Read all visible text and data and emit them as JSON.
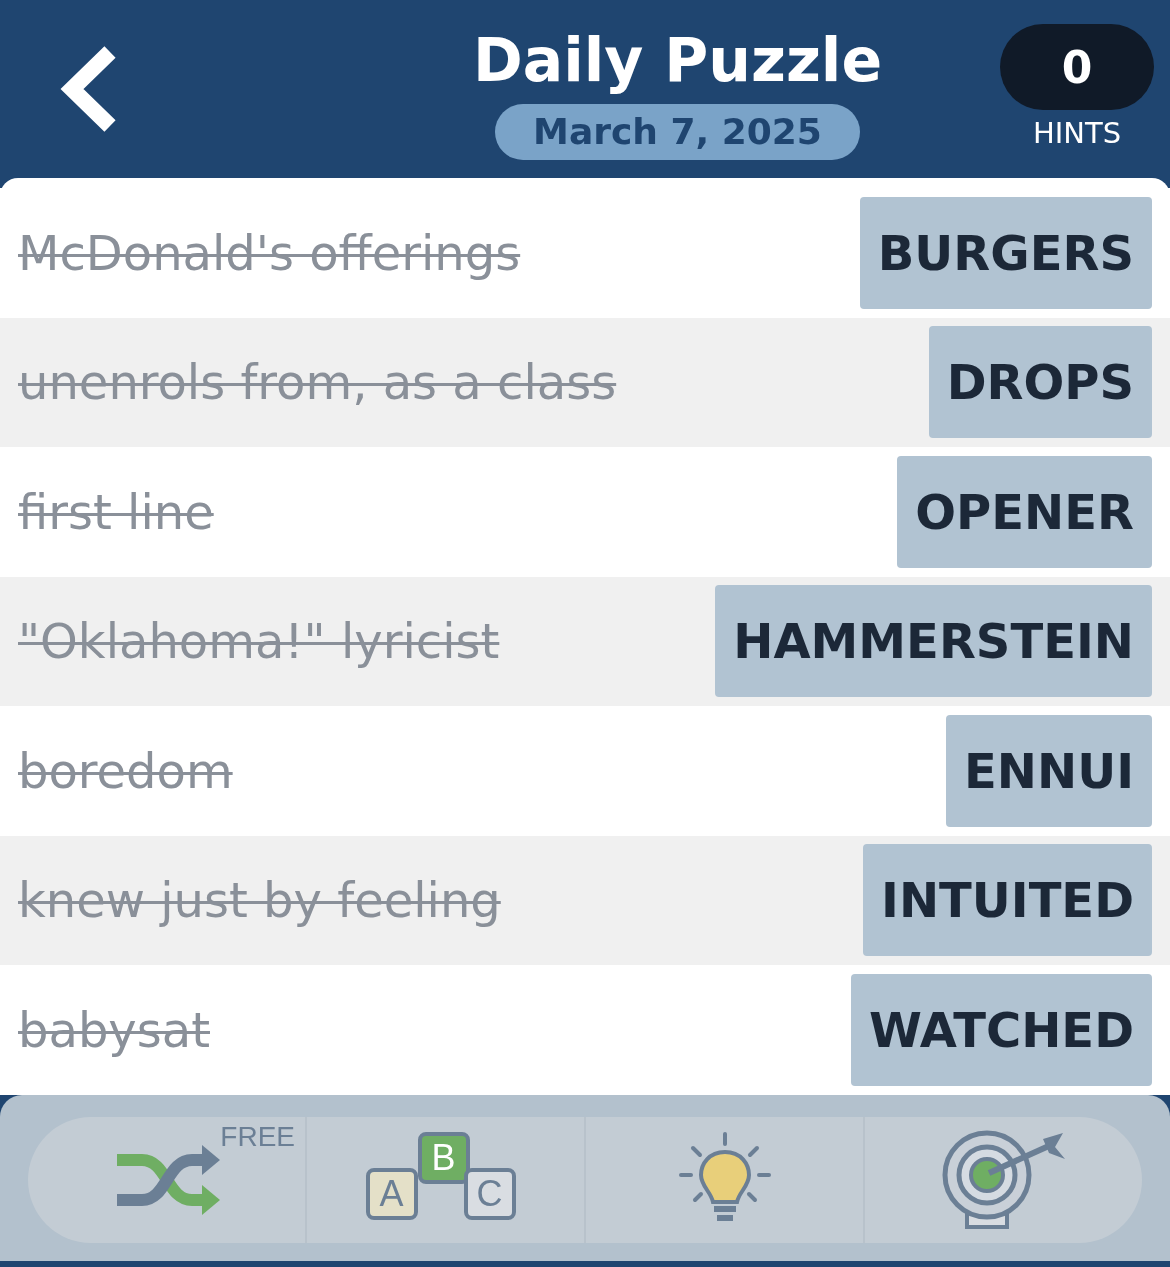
{
  "header": {
    "title": "Daily Puzzle",
    "date": "March 7, 2025",
    "hints_count": "0",
    "hints_label": "HINTS"
  },
  "clues": [
    {
      "clue": "McDonald's offerings",
      "answer": "BURGERS",
      "solved": true
    },
    {
      "clue": "unenrols from, as a class",
      "answer": "DROPS",
      "solved": true
    },
    {
      "clue": "first line",
      "answer": "OPENER",
      "solved": true
    },
    {
      "clue": "\"Oklahoma!\" lyricist",
      "answer": "HAMMERSTEIN",
      "solved": true
    },
    {
      "clue": "boredom",
      "answer": "ENNUI",
      "solved": true
    },
    {
      "clue": "knew just by feeling",
      "answer": "INTUITED",
      "solved": true
    },
    {
      "clue": "babysat",
      "answer": "WATCHED",
      "solved": true
    }
  ],
  "toolbar": [
    {
      "kind": "shuffle",
      "badge": "FREE"
    },
    {
      "kind": "blocks",
      "letters": [
        "A",
        "B",
        "C"
      ]
    },
    {
      "kind": "bulb"
    },
    {
      "kind": "target"
    }
  ]
}
